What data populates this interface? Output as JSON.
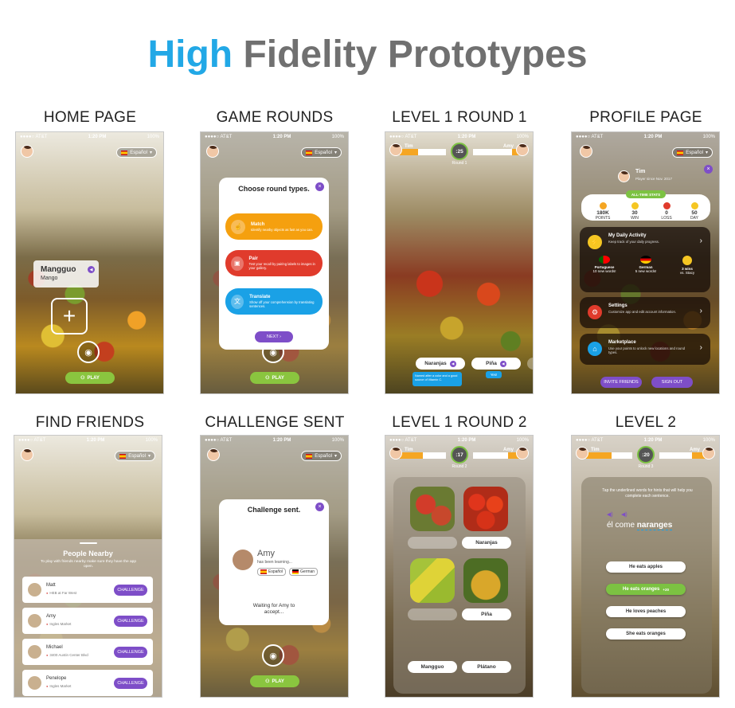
{
  "header": {
    "title_highlight": "High",
    "title_rest": "Fidelity Prototypes"
  },
  "colors": {
    "accent_blue": "#22a8e6",
    "purple": "#7e4ec8",
    "green": "#7cc242",
    "orange": "#f5a623",
    "red": "#e03b2c"
  },
  "status": {
    "carrier": "●●●●○ AT&T",
    "time": "1:20 PM",
    "battery": "100%"
  },
  "lang_label": "Español",
  "play_label": "PLAY",
  "screens": {
    "home": {
      "label": "HOME PAGE",
      "word": "Mangguo",
      "translation": "Mango"
    },
    "game_rounds": {
      "label": "GAME ROUNDS",
      "card_title": "Choose round types.",
      "types": [
        {
          "name": "Match",
          "desc": "Identify nearby objects as fast as you can."
        },
        {
          "name": "Pair",
          "desc": "Test your recall by pairing labels to images in your gallery."
        },
        {
          "name": "Translate",
          "desc": "Show off your comprehension by translating sentences."
        }
      ],
      "next": "NEXT ›"
    },
    "l1r1": {
      "label": "LEVEL 1 ROUND 1",
      "p1": "Tim",
      "p2": "Amy",
      "timer": ":25",
      "round": "Round 1",
      "tag1": "Naranjas",
      "tag2": "Piña",
      "hint": "Named after a color and a good source of Vitamin C.",
      "hint2": "Yes!"
    },
    "profile": {
      "label": "PROFILE PAGE",
      "name": "Tim",
      "since": "Player since Nov. 2017",
      "alltime": "ALL-TIME STATS",
      "stats": [
        {
          "value": "180K",
          "name": "POINTS"
        },
        {
          "value": "30",
          "name": "WIN"
        },
        {
          "value": "0",
          "name": "LOSS"
        },
        {
          "value": "50",
          "name": "DAY"
        }
      ],
      "daily_title": "My Daily Activity",
      "daily_desc": "Keep track of your daily progress.",
      "daily": [
        {
          "lang": "Portuguese",
          "sub": "10 new words!"
        },
        {
          "lang": "German",
          "sub": "5 new words!"
        },
        {
          "lang": "3 wins",
          "sub": "vs. Stacy"
        }
      ],
      "settings_title": "Settings",
      "settings_desc": "Customize app and edit account information.",
      "market_title": "Marketplace",
      "market_desc": "Use your points to unlock new locations and round types.",
      "invite": "INVITE FRIENDS",
      "signout": "SIGN OUT"
    },
    "find": {
      "label": "FIND FRIENDS",
      "heading": "People Nearby",
      "desc": "To play with friends nearby make sure they have the app open.",
      "challenge": "CHALLENGE",
      "friends": [
        {
          "name": "Matt",
          "loc": "HEB at Far West"
        },
        {
          "name": "Amy",
          "loc": "Ingles Market"
        },
        {
          "name": "Michael",
          "loc": "3400 Austin Center Blvd"
        },
        {
          "name": "Penelope",
          "loc": "Ingles Market"
        }
      ]
    },
    "challenge": {
      "label": "CHALLENGE SENT",
      "title": "Challenge sent.",
      "name": "Amy",
      "sub": "has been learning...",
      "lang1": "Español",
      "lang2": "German",
      "waiting": "Waiting for Amy to accept..."
    },
    "l1r2": {
      "label": "LEVEL 1 ROUND 2",
      "p1": "Tim",
      "p2": "Amy",
      "timer": ":17",
      "round": "Round 2",
      "labels": [
        "Naranjas",
        "Piña",
        "Mangguo",
        "Plátano"
      ]
    },
    "level2": {
      "label": "LEVEL 2",
      "p1": "Tim",
      "p2": "Amy",
      "timer": ":20",
      "round": "Round 3",
      "instruction": "Tap the underlined words for hints that will help you complete each sentence.",
      "sentence_a": "él come ",
      "sentence_b": "naranges",
      "options": [
        "He eats apples",
        "He eats oranges",
        "He loves peaches",
        "She eats oranges"
      ],
      "bonus": "+20"
    }
  }
}
